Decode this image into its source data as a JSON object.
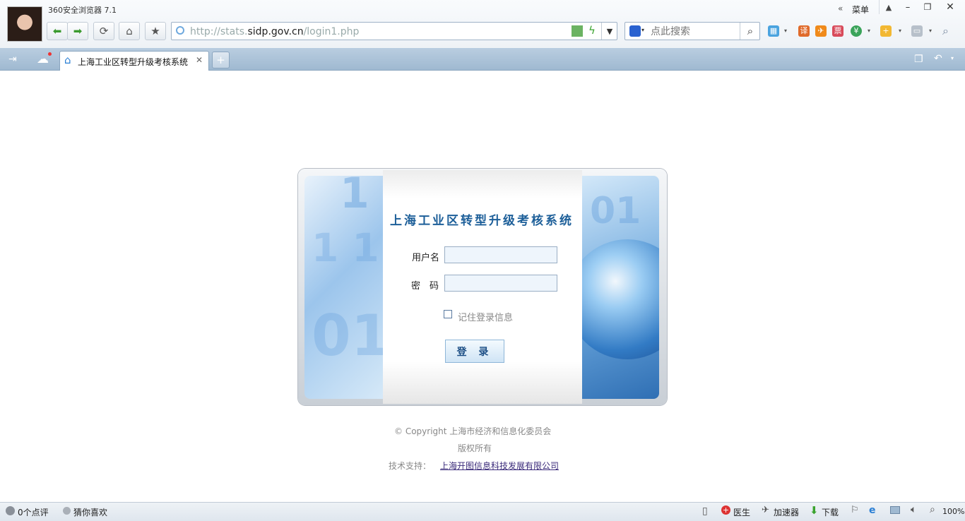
{
  "browser": {
    "app_title": "360安全浏览器 7.1",
    "menu_label": "菜单",
    "address_prefix": "http://stats.",
    "address_domain": "sidp.gov.cn",
    "address_suffix": "/login1.php",
    "search_placeholder": "点此搜索"
  },
  "tab": {
    "title": "上海工业区转型升级考核系统"
  },
  "login": {
    "system_title": "上海工业区转型升级考核系统",
    "username_label": "用户名",
    "password_label": "密　码",
    "username_value": "",
    "password_value": "",
    "remember_label": "记住登录信息",
    "login_button": "登 录"
  },
  "footer": {
    "copyright": "© Copyright  上海市经济和信息化委员会",
    "rights": "版权所有",
    "support_label": "技术支持：",
    "support_company": "上海开图信息科技发展有限公司"
  },
  "statusbar": {
    "comments": "0个点评",
    "guess": "猜你喜欢",
    "doctor": "医生",
    "accelerator": "加速器",
    "download": "下载",
    "zoom": "100%"
  },
  "colors": {
    "title_blue": "#1d5f99",
    "tabbar": "#9fb9d1"
  }
}
